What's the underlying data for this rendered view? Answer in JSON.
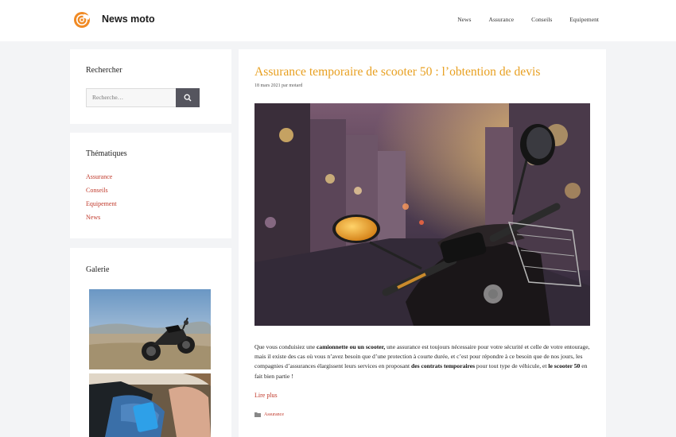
{
  "header": {
    "site_title": "News moto",
    "nav": [
      "News",
      "Assurance",
      "Conseils",
      "Equipement"
    ]
  },
  "sidebar": {
    "search": {
      "title": "Rechercher",
      "placeholder": "Recherche…",
      "button_icon": "search-icon"
    },
    "categories": {
      "title": "Thématiques",
      "items": [
        "Assurance",
        "Conseils",
        "Equipement",
        "News"
      ]
    },
    "gallery": {
      "title": "Galerie"
    }
  },
  "article": {
    "title": "Assurance temporaire de scooter 50 : l’obtention de devis",
    "date": "18 mars 2021",
    "by": "par",
    "author": "motard",
    "text": {
      "p1": "Que vous conduisiez une ",
      "b1": "camionnette ou un scooter,",
      "p2": " une assurance est toujours nécessaire pour votre sécurité et celle de votre entourage, mais il existe des cas où vous n’avez besoin que d’une protection à courte durée, et c’est pour répondre à ce besoin que de nos jours, les compagnies d’assurances élargissent leurs services en proposant ",
      "b2": "des contrats temporaires",
      "p3": " pour tout type de véhicule, et ",
      "b3": "le scooter 50",
      "p4": " en fait bien partie !"
    },
    "read_more": "Lire plus",
    "category": "Assurance",
    "category_icon": "folder-icon"
  },
  "colors": {
    "accent_title": "#e8a021",
    "link": "#c0392b",
    "search_button": "#55555e"
  }
}
